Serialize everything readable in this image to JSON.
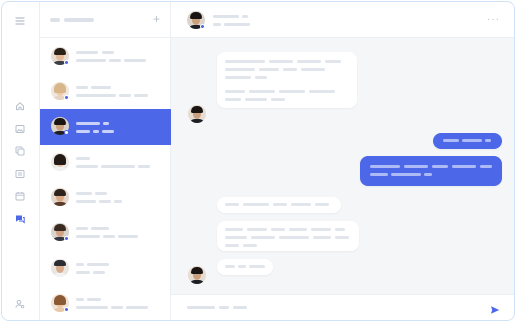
{
  "rail": {
    "icons": [
      "menu-icon",
      "home-icon",
      "image-icon",
      "copy-icon",
      "list-icon",
      "calendar-icon",
      "chat-icon",
      "user-settings-icon"
    ],
    "active": "chat-icon",
    "colors": {
      "icon": "#b7bfcc",
      "active": "#4c67e8"
    }
  },
  "list": {
    "icons": [
      "plus-icon"
    ],
    "items": [
      {
        "avatar": "avatar-man-beard",
        "online": true,
        "active": false
      },
      {
        "avatar": "avatar-woman-blonde",
        "online": true,
        "active": false
      },
      {
        "avatar": "avatar-man-dark",
        "online": true,
        "active": true
      },
      {
        "avatar": "avatar-woman-dark-hair",
        "online": false,
        "active": false
      },
      {
        "avatar": "avatar-man-glasses",
        "online": false,
        "active": false
      },
      {
        "avatar": "avatar-man-beard-2",
        "online": true,
        "active": false
      },
      {
        "avatar": "avatar-man-cap",
        "online": false,
        "active": false
      },
      {
        "avatar": "avatar-woman-smile",
        "online": true,
        "active": false
      }
    ]
  },
  "chat": {
    "header_avatar": "avatar-man-dark",
    "header_online": true,
    "icons": [
      "more-icon",
      "send-icon"
    ],
    "colors": {
      "accent": "#4c67e8",
      "background": "#f5f6f8"
    }
  }
}
